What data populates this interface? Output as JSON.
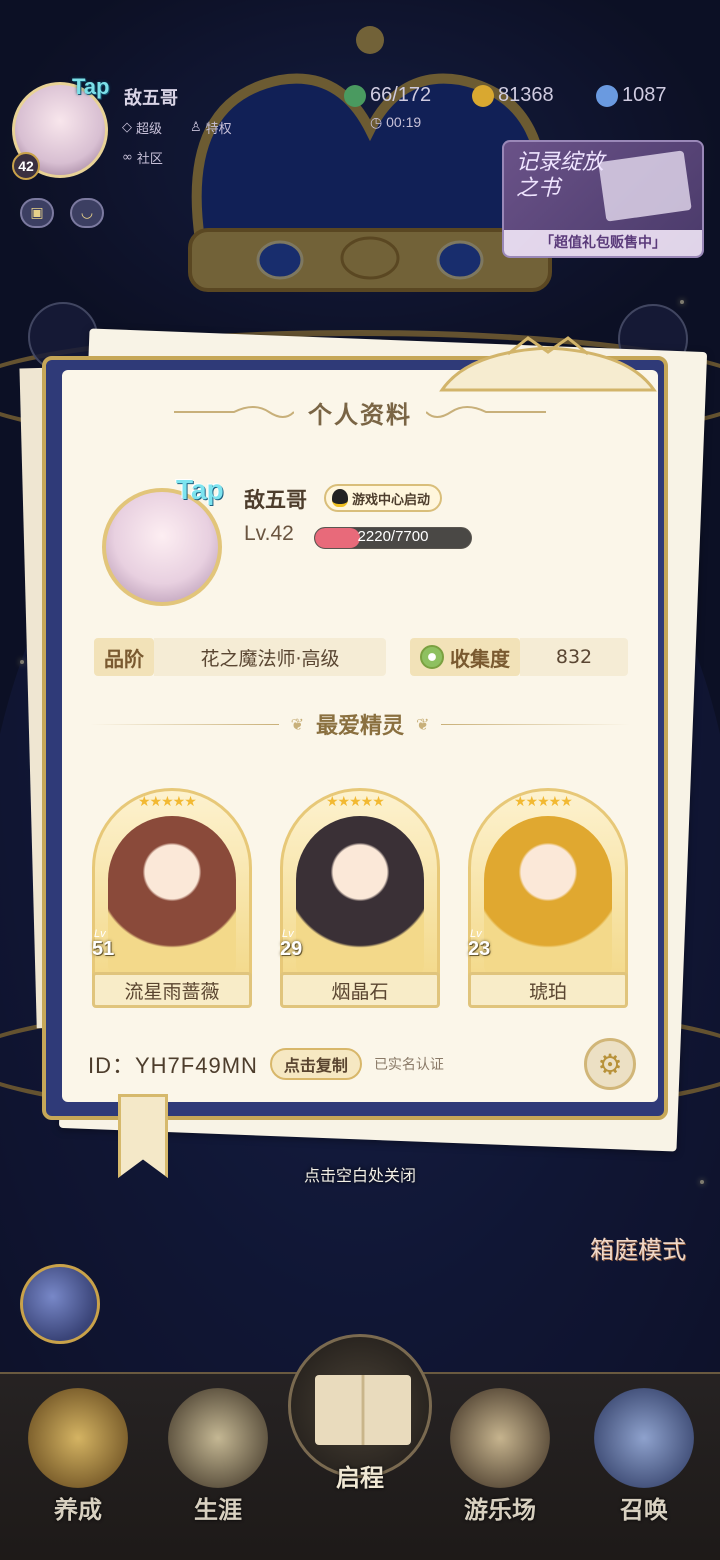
{
  "hud": {
    "player_name": "敌五哥",
    "level": "42",
    "tap_logo": "Tap",
    "tags": [
      "超级",
      "特权",
      "社区"
    ],
    "stamina": "66/172",
    "gold": "81368",
    "diamond": "1087",
    "timer": "00:19",
    "promo": {
      "title": "记录绽放之书",
      "subtitle": "「超值礼包贩售中」"
    }
  },
  "profile": {
    "title": "个人资料",
    "tap_logo": "Tap",
    "name": "敌五哥",
    "qq_badge": "游戏中心启动",
    "level_label": "Lv.42",
    "xp_text": "2220/7700",
    "xp_current": 2220,
    "xp_max": 7700,
    "rank_label": "品阶",
    "rank_value": "花之魔法师·高级",
    "collect_label": "收集度",
    "collect_value": "832",
    "fav_title": "最爱精灵",
    "spirits": [
      {
        "name": "流星雨蔷薇",
        "level": "51",
        "lv_tag": "Lv",
        "stars": "★★★★★",
        "color": "#8a4a3a"
      },
      {
        "name": "烟晶石",
        "level": "29",
        "lv_tag": "Lv",
        "stars": "★★★★★",
        "color": "#3a3036"
      },
      {
        "name": "琥珀",
        "level": "23",
        "lv_tag": "Lv",
        "stars": "★★★★★",
        "color": "#e0a830"
      }
    ],
    "id_text": "ID：YH7F49MN",
    "copy_button": "点击复制",
    "verified": "已实名认证",
    "settings_icon": "gear-icon"
  },
  "close_hint": "点击空白处关闭",
  "garden_mode": "箱庭模式",
  "nav": {
    "items": [
      {
        "label": "养成",
        "icon": "character-icon"
      },
      {
        "label": "生涯",
        "icon": "crown-icon"
      },
      {
        "label": "游乐场",
        "icon": "star-icon"
      },
      {
        "label": "召唤",
        "icon": "summon-card-icon"
      }
    ],
    "center_label": "启程"
  },
  "colors": {
    "accent_gold": "#c6a758",
    "card_bg": "#fbf6e9",
    "xp_fill": "#e86a7a",
    "frame_blue": "#2f3a78"
  }
}
